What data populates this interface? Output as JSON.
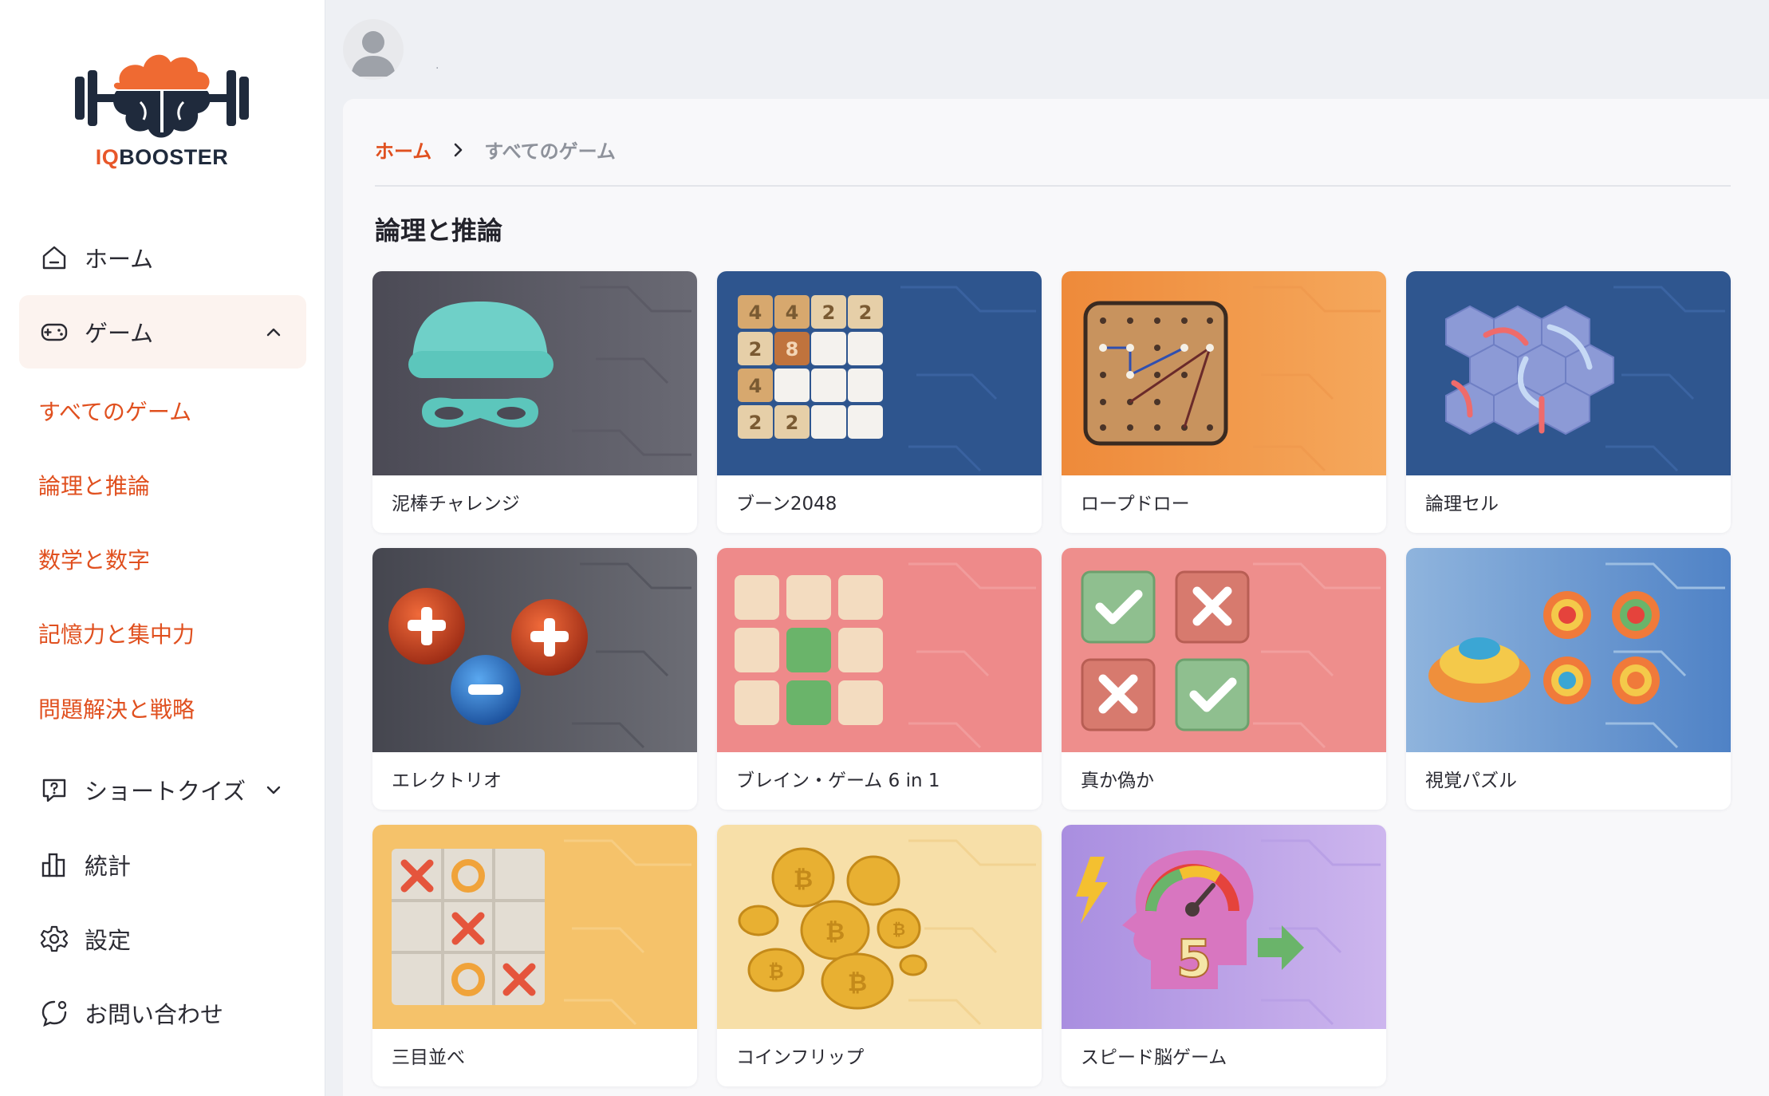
{
  "brand": {
    "logo_prefix": "IQ",
    "logo_suffix": "BOOSTER"
  },
  "colors": {
    "accent": "#e0501f",
    "sidebar_active_bg": "#fcf3ef",
    "page_bg": "#eef0f4"
  },
  "sidebar": {
    "home": "ホーム",
    "games": "ゲーム",
    "games_sub": [
      "すべてのゲーム",
      "論理と推論",
      "数学と数字",
      "記憶力と集中力",
      "問題解決と戦略"
    ],
    "quiz": "ショートクイズ",
    "stats": "統計",
    "settings": "設定",
    "contact": "お問い合わせ"
  },
  "header": {
    "username": "."
  },
  "breadcrumb": {
    "home": "ホーム",
    "current": "すべてのゲーム"
  },
  "section": {
    "title": "論理と推論"
  },
  "games": [
    {
      "name": "泥棒チャレンジ",
      "icon": "thief-mask-icon"
    },
    {
      "name": "ブーン2048",
      "icon": "tile-2048-icon"
    },
    {
      "name": "ロープドロー",
      "icon": "pegboard-rope-icon"
    },
    {
      "name": "論理セル",
      "icon": "hex-cells-icon"
    },
    {
      "name": "エレクトリオ",
      "icon": "charge-orbs-icon"
    },
    {
      "name": "ブレイン・ゲーム 6 in 1",
      "icon": "tile-grid-icon"
    },
    {
      "name": "真か偽か",
      "icon": "check-cross-icon"
    },
    {
      "name": "視覚パズル",
      "icon": "ring-targets-icon"
    },
    {
      "name": "三目並べ",
      "icon": "tic-tac-toe-icon"
    },
    {
      "name": "コインフリップ",
      "icon": "coins-icon"
    },
    {
      "name": "スピード脳ゲーム",
      "icon": "speed-brain-icon"
    }
  ],
  "tiles_2048": [
    "4",
    "4",
    "2",
    "2",
    "2",
    "8",
    "4",
    "2",
    "2"
  ],
  "speed_number": "5"
}
